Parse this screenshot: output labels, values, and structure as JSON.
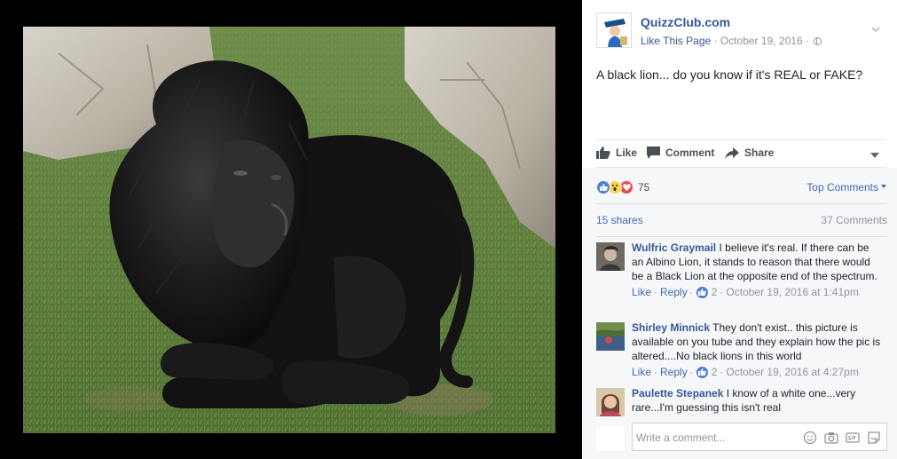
{
  "post": {
    "page_name": "QuizzClub.com",
    "like_page": "Like This Page",
    "separator": "·",
    "date": "October 19, 2016",
    "text": "A black lion... do you know if it's REAL or FAKE?"
  },
  "actions": {
    "like": "Like",
    "comment": "Comment",
    "share": "Share"
  },
  "reactions": {
    "count": "75",
    "sort_label": "Top Comments",
    "shares": "15 shares",
    "comments": "37 Comments"
  },
  "comments": [
    {
      "name": "Wulfric Graymail",
      "text": "I believe it's real. If there can be an Albino Lion, it stands to reason that there would be a Black Lion at the opposite end of the spectrum.",
      "like": "Like",
      "reply": "Reply",
      "likes": "2",
      "time": "October 19, 2016 at 1:41pm"
    },
    {
      "name": "Shirley Minnick",
      "text": "They don't exist.. this picture is available on you tube and they explain how the pic is altered....No black lions in this world",
      "like": "Like",
      "reply": "Reply",
      "likes": "2",
      "time": "October 19, 2016 at 4:27pm"
    },
    {
      "name": "Paulette Stepanek",
      "text": "I know of a white one...very rare...I'm guessing this isn't real"
    }
  ],
  "composer": {
    "placeholder": "Write a comment..."
  },
  "colors": {
    "link": "#365899",
    "accent": "#4267b2",
    "muted": "#90949c",
    "panel_bg": "#f6f7f9"
  }
}
